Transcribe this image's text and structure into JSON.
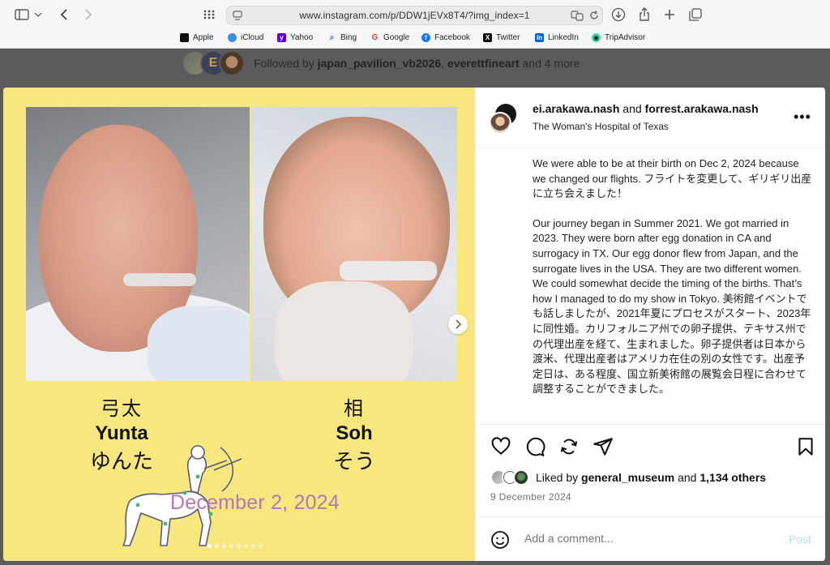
{
  "browser": {
    "url": "www.instagram.com/p/DDW1jEVx8T4/?img_index=1",
    "bookmarks": [
      {
        "label": "Apple",
        "icon": "apple-icon",
        "color": "#111111"
      },
      {
        "label": "iCloud",
        "icon": "icloud-icon",
        "color": "#3a8ee6"
      },
      {
        "label": "Yahoo",
        "icon": "yahoo-icon",
        "color": "#6001d2"
      },
      {
        "label": "Bing",
        "icon": "bing-icon",
        "color": "#2b6fcf"
      },
      {
        "label": "Google",
        "icon": "google-icon",
        "color": "#ea4335"
      },
      {
        "label": "Facebook",
        "icon": "facebook-icon",
        "color": "#1877f2"
      },
      {
        "label": "Twitter",
        "icon": "twitter-icon",
        "color": "#111111"
      },
      {
        "label": "LinkedIn",
        "icon": "linkedin-icon",
        "color": "#0a66c2"
      },
      {
        "label": "TripAdvisor",
        "icon": "tripadvisor-icon",
        "color": "#34e0a1"
      }
    ]
  },
  "background_page": {
    "followed_prefix": "Followed by",
    "followed_user1": "japan_pavilion_vb2026",
    "followed_sep": ",",
    "followed_user2": "everettfineart",
    "followed_suffix": "and 4 more"
  },
  "media": {
    "left_kanji": "弓太",
    "left_roman": "Yunta",
    "left_kana": "ゆんた",
    "right_kanji": "相",
    "right_roman": "Soh",
    "right_kana": "そう",
    "date": "December 2, 2024",
    "carousel_count": 8,
    "carousel_active": 0
  },
  "post": {
    "author1": "ei.arakawa.nash",
    "and_word": "and",
    "author2": "forrest.arakawa.nash",
    "location": "The Woman's Hospital of Texas",
    "caption_p1": "We were able to be at their birth on Dec 2, 2024 because we changed our flights. フライトを変更して、ギリギリ出産に立ち会えました！",
    "caption_p2": "Our journey began in Summer 2021. We got married in 2023. They were born after egg donation in CA and surrogacy in TX. Our egg donor flew from Japan, and the surrogate lives in the USA. They are two different women. We could somewhat decide the timing of the births. That’s how I managed to do my show in Tokyo. 美術館イベントでも話しましたが、2021年夏にプロセスがスタート、2023年に同性婚。カリフォルニア州での卵子提供、テキサス州での代理出産を経て、生まれました。卵子提供者は日本から渡米、代理出産者はアメリカ在住の別の女性です。出産予定日は、ある程度、国立新美術館の展覧会日程に合わせて調整することができました。",
    "likes_prefix": "Liked by",
    "likes_user": "general_museum",
    "likes_and": "and",
    "likes_count": "1,134 others",
    "date": "9 December 2024",
    "comment_placeholder": "Add a comment...",
    "post_label": "Post"
  }
}
